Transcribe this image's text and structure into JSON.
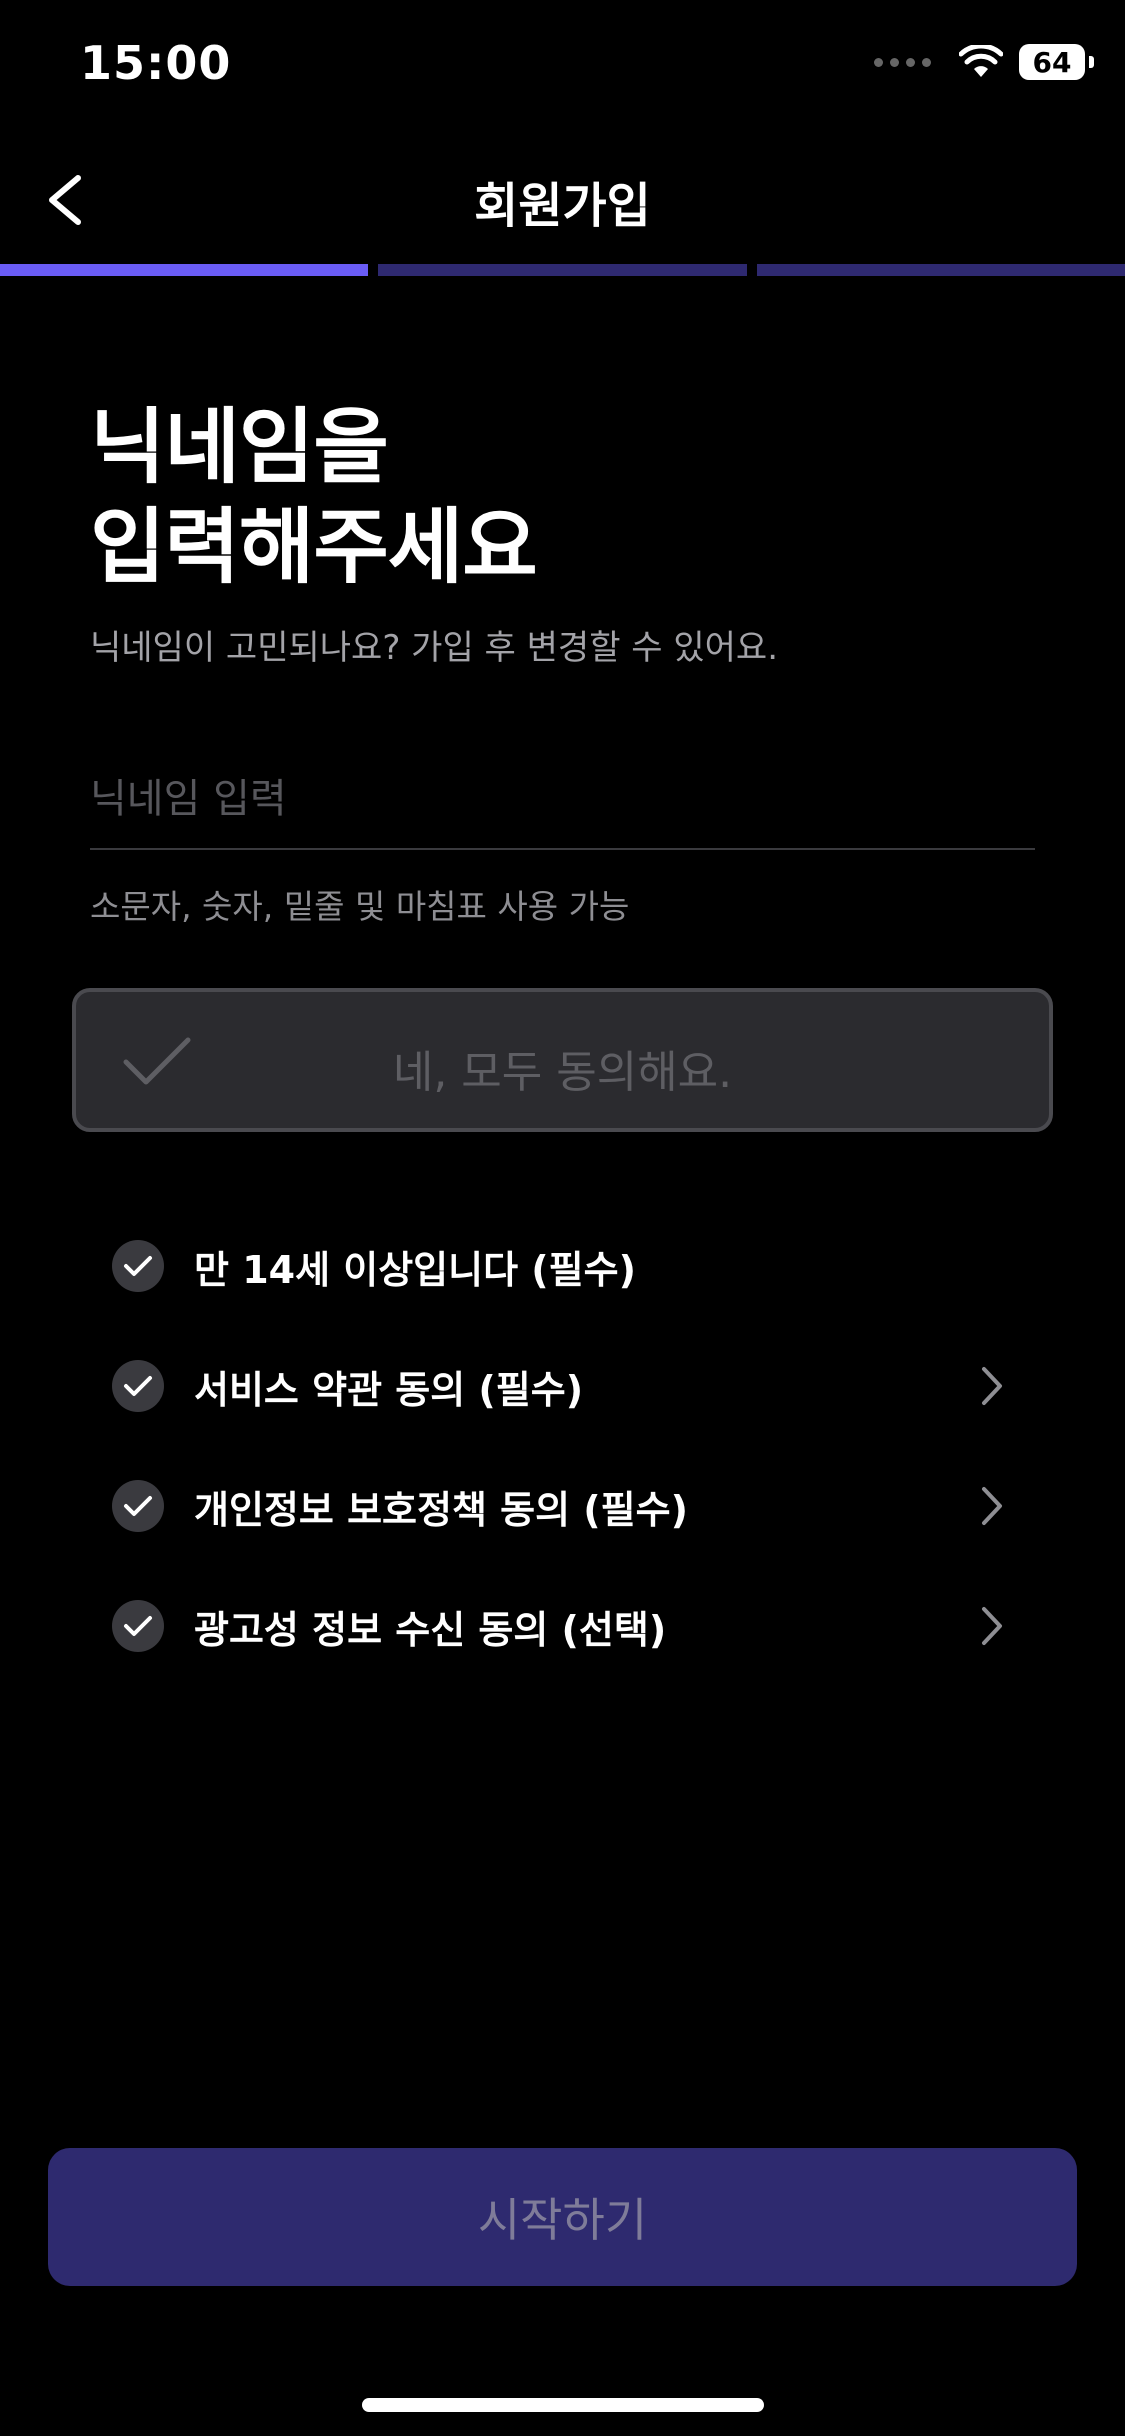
{
  "status_bar": {
    "time": "15:00",
    "battery": "64"
  },
  "nav": {
    "title": "회원가입",
    "back_icon": "chevron-left-icon"
  },
  "progress": {
    "total_steps": 3,
    "current_step": 1,
    "colors": {
      "active": "#6a5cf5",
      "inactive": "#2e2970"
    }
  },
  "heading": {
    "line1": "닉네임을",
    "line2": "입력해주세요"
  },
  "subtitle": "닉네임이 고민되나요? 가입 후 변경할 수 있어요.",
  "nickname": {
    "placeholder": "닉네임 입력",
    "value": "",
    "hint": "소문자, 숫자, 밑줄 및 마침표 사용 가능"
  },
  "agree_all": {
    "label": "네, 모두 동의해요.",
    "icon": "checkmark-icon"
  },
  "terms": [
    {
      "label": "만 14세 이상입니다 (필수)",
      "has_arrow": false
    },
    {
      "label": "서비스 약관 동의 (필수)",
      "has_arrow": true
    },
    {
      "label": "개인정보 보호정책 동의 (필수)",
      "has_arrow": true
    },
    {
      "label": "광고성 정보 수신 동의 (선택)",
      "has_arrow": true
    }
  ],
  "start_button": {
    "label": "시작하기",
    "color": "#2e2a6f"
  }
}
